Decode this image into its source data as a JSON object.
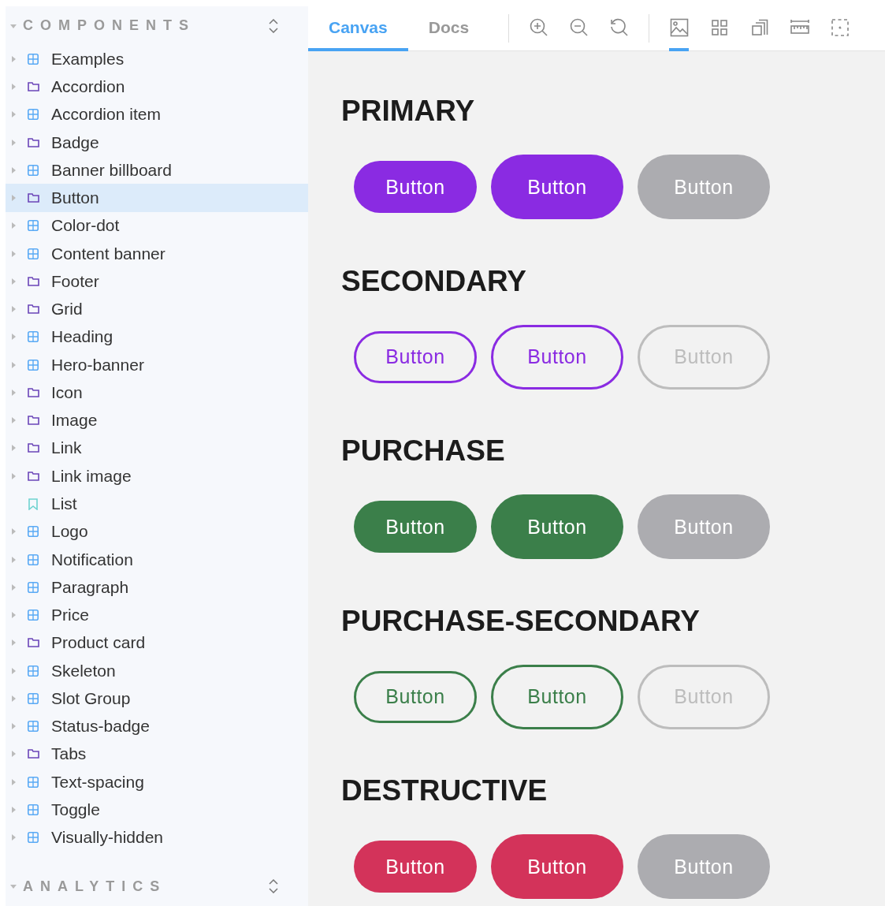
{
  "sidebar": {
    "sections": [
      {
        "title": "COMPONENTS",
        "expanded": true,
        "items": [
          {
            "label": "Examples",
            "kind": "component",
            "selected": false
          },
          {
            "label": "Accordion",
            "kind": "folder",
            "selected": false
          },
          {
            "label": "Accordion item",
            "kind": "component",
            "selected": false
          },
          {
            "label": "Badge",
            "kind": "folder",
            "selected": false
          },
          {
            "label": "Banner billboard",
            "kind": "component",
            "selected": false
          },
          {
            "label": "Button",
            "kind": "folder",
            "selected": true
          },
          {
            "label": "Color-dot",
            "kind": "component",
            "selected": false
          },
          {
            "label": "Content banner",
            "kind": "component",
            "selected": false
          },
          {
            "label": "Footer",
            "kind": "folder",
            "selected": false
          },
          {
            "label": "Grid",
            "kind": "folder",
            "selected": false
          },
          {
            "label": "Heading",
            "kind": "component",
            "selected": false
          },
          {
            "label": "Hero-banner",
            "kind": "component",
            "selected": false
          },
          {
            "label": "Icon",
            "kind": "folder",
            "selected": false
          },
          {
            "label": "Image",
            "kind": "folder",
            "selected": false
          },
          {
            "label": "Link",
            "kind": "folder",
            "selected": false
          },
          {
            "label": "Link image",
            "kind": "folder",
            "selected": false
          },
          {
            "label": "List",
            "kind": "story",
            "selected": false
          },
          {
            "label": "Logo",
            "kind": "component",
            "selected": false
          },
          {
            "label": "Notification",
            "kind": "component",
            "selected": false
          },
          {
            "label": "Paragraph",
            "kind": "component",
            "selected": false
          },
          {
            "label": "Price",
            "kind": "component",
            "selected": false
          },
          {
            "label": "Product card",
            "kind": "folder",
            "selected": false
          },
          {
            "label": "Skeleton",
            "kind": "component",
            "selected": false
          },
          {
            "label": "Slot Group",
            "kind": "component",
            "selected": false
          },
          {
            "label": "Status-badge",
            "kind": "component",
            "selected": false
          },
          {
            "label": "Tabs",
            "kind": "folder",
            "selected": false
          },
          {
            "label": "Text-spacing",
            "kind": "component",
            "selected": false
          },
          {
            "label": "Toggle",
            "kind": "component",
            "selected": false
          },
          {
            "label": "Visually-hidden",
            "kind": "component",
            "selected": false
          }
        ]
      },
      {
        "title": "ANALYTICS",
        "expanded": true
      }
    ]
  },
  "toolbar": {
    "tabs": [
      {
        "label": "Canvas",
        "selected": true
      },
      {
        "label": "Docs",
        "selected": false
      }
    ],
    "zoom_tools": [
      {
        "kind": "zoom-in"
      },
      {
        "kind": "zoom-out"
      },
      {
        "kind": "zoom-reset"
      }
    ],
    "addons": [
      {
        "kind": "background",
        "selected": true
      },
      {
        "kind": "grid",
        "selected": false
      },
      {
        "kind": "viewport",
        "selected": false
      },
      {
        "kind": "measure",
        "selected": false
      },
      {
        "kind": "outline",
        "selected": false
      }
    ]
  },
  "canvas": {
    "sections": [
      {
        "heading": "PRIMARY",
        "kind": "primary",
        "buttons": [
          {
            "label": "Button",
            "kind": "small",
            "disabled": false
          },
          {
            "label": "Button",
            "kind": "large",
            "disabled": false
          },
          {
            "label": "Button",
            "kind": "large",
            "disabled": true
          }
        ]
      },
      {
        "heading": "SECONDARY",
        "kind": "secondary",
        "buttons": [
          {
            "label": "Button",
            "kind": "small",
            "disabled": false
          },
          {
            "label": "Button",
            "kind": "large",
            "disabled": false
          },
          {
            "label": "Button",
            "kind": "large",
            "disabled": true
          }
        ]
      },
      {
        "heading": "PURCHASE",
        "kind": "purchase",
        "buttons": [
          {
            "label": "Button",
            "kind": "small",
            "disabled": false
          },
          {
            "label": "Button",
            "kind": "large",
            "disabled": false
          },
          {
            "label": "Button",
            "kind": "large",
            "disabled": true
          }
        ]
      },
      {
        "heading": "PURCHASE-SECONDARY",
        "kind": "purchase-secondary",
        "buttons": [
          {
            "label": "Button",
            "kind": "small",
            "disabled": false
          },
          {
            "label": "Button",
            "kind": "large",
            "disabled": false
          },
          {
            "label": "Button",
            "kind": "large",
            "disabled": true
          }
        ]
      },
      {
        "heading": "DESTRUCTIVE",
        "kind": "destructive",
        "buttons": [
          {
            "label": "Button",
            "kind": "small",
            "disabled": false
          },
          {
            "label": "Button",
            "kind": "large",
            "disabled": false
          },
          {
            "label": "Button",
            "kind": "large",
            "disabled": true
          }
        ]
      }
    ]
  }
}
